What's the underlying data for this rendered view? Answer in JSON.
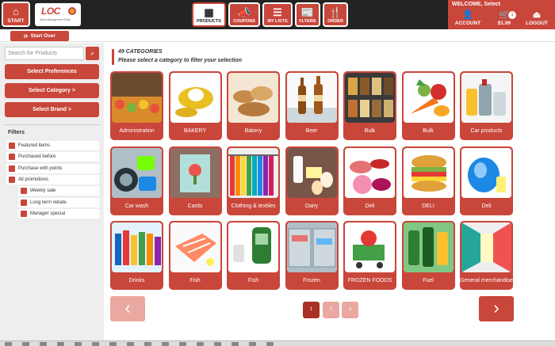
{
  "topbar": {
    "start_label": "START",
    "logo_text": "LOC",
    "logo_sub": "Store Management Suite",
    "nav": [
      {
        "label": "PRODUCTS",
        "icon": "grid-icon",
        "glyph": "▦"
      },
      {
        "label": "COUPONS",
        "icon": "megaphone-icon",
        "glyph": "📣"
      },
      {
        "label": "MY LISTS",
        "icon": "list-icon",
        "glyph": "☰"
      },
      {
        "label": "FLYERS",
        "icon": "newspaper-icon",
        "glyph": "📰"
      },
      {
        "label": "ORDER",
        "icon": "cutlery-icon",
        "glyph": "🍴"
      }
    ],
    "account": {
      "welcome": "WELCOME, Select",
      "account_label": "ACCOUNT",
      "cart_amount": "$1.99",
      "cart_count": "1",
      "logout_label": "LOGOUT"
    }
  },
  "subbar": {
    "start_over": "Start Over"
  },
  "sidebar": {
    "search_placeholder": "Search for Products",
    "buttons": [
      "Select Preferences",
      "Select Category >",
      "Select Brand >"
    ],
    "filters_heading": "Filters",
    "filters": [
      {
        "label": "Featured items",
        "level": 0
      },
      {
        "label": "Purchased before",
        "level": 0
      },
      {
        "label": "Purchase with points",
        "level": 0
      },
      {
        "label": "All promotions",
        "level": 0
      },
      {
        "label": "Weekly sale",
        "level": 1
      },
      {
        "label": "Long term rebate",
        "level": 1
      },
      {
        "label": "Manager special",
        "level": 1
      }
    ]
  },
  "main": {
    "count_label": "49 CATEGORIES",
    "hint": "Please select a category to filter your selection",
    "categories": [
      {
        "label": "Administration",
        "image": "market-stall-image"
      },
      {
        "label": "BAKERY",
        "image": "croissant-image"
      },
      {
        "label": "Bakery",
        "image": "bread-basket-image"
      },
      {
        "label": "Beer",
        "image": "beer-bottles-image"
      },
      {
        "label": "Bulk",
        "image": "bulk-bins-image"
      },
      {
        "label": "Bulk",
        "image": "vegetables-image"
      },
      {
        "label": "Car products",
        "image": "car-products-image"
      },
      {
        "label": "Car wash",
        "image": "car-wash-image"
      },
      {
        "label": "Cards",
        "image": "greeting-card-image"
      },
      {
        "label": "Clothing & textiles",
        "image": "clothing-rack-image"
      },
      {
        "label": "Dairy",
        "image": "dairy-image"
      },
      {
        "label": "Deli",
        "image": "deli-meats-image"
      },
      {
        "label": "DELI",
        "image": "sandwich-image"
      },
      {
        "label": "Deli",
        "image": "juice-jug-image"
      },
      {
        "label": "Drinks",
        "image": "drink-bottles-image"
      },
      {
        "label": "Fish",
        "image": "salmon-image"
      },
      {
        "label": "Fish",
        "image": "fish-products-image"
      },
      {
        "label": "Frozen",
        "image": "freezer-image"
      },
      {
        "label": "FROZEN FOODS",
        "image": "frozen-cart-image"
      },
      {
        "label": "Fuel",
        "image": "fuel-pump-image"
      },
      {
        "label": "General merchandise",
        "image": "store-aisle-image"
      }
    ],
    "pager": {
      "pages": [
        "1",
        "2",
        "3"
      ],
      "current": "1",
      "prev_glyph": "‹",
      "next_glyph": "›"
    }
  },
  "colors": {
    "accent": "#c9463a",
    "topbar": "#232323",
    "sidebar": "#eeeeee"
  }
}
